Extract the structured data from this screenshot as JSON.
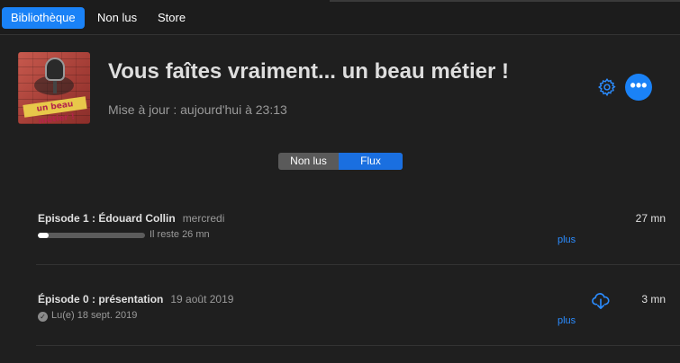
{
  "tabs": [
    "Bibliothèque",
    "Non lus",
    "Store"
  ],
  "podcast": {
    "title": "Vous faîtes vraiment... un beau métier !",
    "updated": "Mise à jour : aujourd'hui à 23:13",
    "artwork_text": "un beau métier !"
  },
  "segment": {
    "unread": "Non lus",
    "feed": "Flux",
    "selected": "Flux"
  },
  "episodes": [
    {
      "title": "Episode 1 :  Édouard Collin",
      "date": "mercredi",
      "remaining": "Il reste 26 mn",
      "progress": 0.1,
      "duration": "27 mn",
      "more": "plus"
    },
    {
      "title": "Épisode 0 : présentation",
      "date": "19 août 2019",
      "played": "Lu(e) 18 sept. 2019",
      "duration": "3 mn",
      "more": "plus"
    }
  ],
  "icons": {
    "settings": "gear-icon",
    "more": "ellipsis-icon",
    "download": "cloud-download-icon",
    "played": "checkmark-icon"
  },
  "colors": {
    "accent": "#1a82f7",
    "background": "#1f1f1f",
    "link": "#2b8cff"
  }
}
